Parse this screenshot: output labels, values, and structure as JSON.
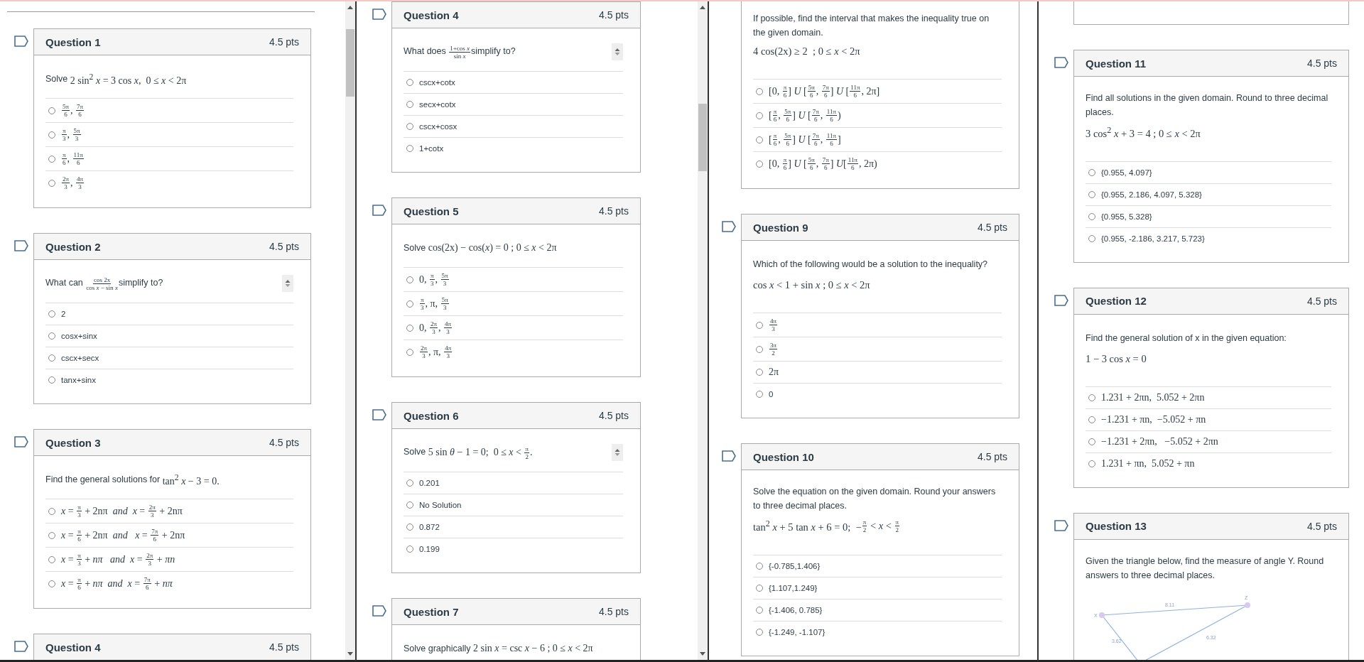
{
  "panes": [
    {
      "leading_rule": true,
      "scrollbar": true,
      "questions": [
        {
          "title": "Question 1",
          "points": "4.5 pts",
          "prompt": [
            "Solve ",
            {
              "math": [
                "2 sin$^{2}$ *x* = 3 cos *x*,  0 ≤ *x* < 2π"
              ]
            }
          ],
          "options": [
            {
              "selected": false,
              "math": [
                [
                  "5π",
                  "6"
                ],
                ", ",
                [
                  "7π",
                  "6"
                ]
              ]
            },
            {
              "selected": false,
              "math": [
                [
                  "π",
                  "3"
                ],
                ", ",
                [
                  "5π",
                  "3"
                ]
              ]
            },
            {
              "selected": false,
              "math": [
                [
                  "π",
                  "6"
                ],
                ", ",
                [
                  "11π",
                  "6"
                ]
              ]
            },
            {
              "selected": false,
              "math": [
                [
                  "2π",
                  "3"
                ],
                ", ",
                [
                  "4π",
                  "3"
                ]
              ]
            }
          ]
        },
        {
          "title": "Question 2",
          "points": "4.5 pts",
          "spinner": true,
          "prompt": [
            "What can ",
            {
              "math": [
                [
                  "cos 2x",
                  "cos *x* − sin *x*"
                ]
              ]
            },
            "simplify to?"
          ],
          "options": [
            {
              "selected": false,
              "text": "2"
            },
            {
              "selected": false,
              "text": "cosx+sinx"
            },
            {
              "selected": false,
              "text": "cscx+secx"
            },
            {
              "selected": false,
              "text": "tanx+sinx"
            }
          ]
        },
        {
          "title": "Question 3",
          "points": "4.5 pts",
          "prompt": [
            "Find the general solutions for ",
            {
              "math": [
                "tan$^{2}$ *x* − 3 = 0."
              ]
            }
          ],
          "options": [
            {
              "selected": false,
              "math": [
                "*x* = ",
                [
                  "π",
                  "3"
                ],
                " + 2nπ  *and*  *x* = ",
                [
                  "2π",
                  "3"
                ],
                " + 2nπ"
              ]
            },
            {
              "selected": false,
              "math": [
                "*x* = ",
                [
                  "π",
                  "6"
                ],
                " + 2nπ  *and*   *x* = ",
                [
                  "7π",
                  "6"
                ],
                " + 2nπ"
              ]
            },
            {
              "selected": false,
              "math": [
                "*x* = ",
                [
                  "π",
                  "3"
                ],
                " + *nπ*   *and*  *x* = ",
                [
                  "2π",
                  "3"
                ],
                " + *πn*"
              ]
            },
            {
              "selected": false,
              "math": [
                "*x* = ",
                [
                  "π",
                  "6"
                ],
                " + *nπ*  *and*  *x* = ",
                [
                  "7π",
                  "6"
                ],
                " + *nπ*"
              ]
            }
          ]
        },
        {
          "title": "Question 4",
          "points": "4.5 pts"
        }
      ]
    },
    {
      "scrollbar": true,
      "questions": [
        {
          "title": "Question 4",
          "points": "4.5 pts",
          "spinner": true,
          "prompt": [
            "What does ",
            {
              "math": [
                [
                  "1+cos *x*",
                  "sin *x*"
                ]
              ]
            },
            "simplify to?"
          ],
          "options": [
            {
              "selected": false,
              "text": "cscx+cotx"
            },
            {
              "selected": false,
              "text": "secx+cotx"
            },
            {
              "selected": false,
              "text": "cscx+cosx"
            },
            {
              "selected": false,
              "text": "1+cotx"
            }
          ]
        },
        {
          "title": "Question 5",
          "points": "4.5 pts",
          "prompt": [
            "Solve ",
            {
              "math": [
                "cos(2x) − cos(*x*) = 0 ; 0 ≤ *x* < 2π"
              ]
            }
          ],
          "options": [
            {
              "selected": false,
              "math": [
                "0, ",
                [
                  "π",
                  "3"
                ],
                ", ",
                [
                  "5π",
                  "3"
                ]
              ]
            },
            {
              "selected": false,
              "math": [
                [
                  "π",
                  "3"
                ],
                ", π, ",
                [
                  "5π",
                  "3"
                ]
              ]
            },
            {
              "selected": false,
              "math": [
                "0, ",
                [
                  "2π",
                  "3"
                ],
                ", ",
                [
                  "4π",
                  "3"
                ]
              ]
            },
            {
              "selected": false,
              "math": [
                [
                  "2π",
                  "3"
                ],
                ", π, ",
                [
                  "4π",
                  "3"
                ]
              ]
            }
          ]
        },
        {
          "title": "Question 6",
          "points": "4.5 pts",
          "spinner": true,
          "prompt": [
            "Solve ",
            {
              "math": [
                "5 sin *θ* − 1 = 0;  0 ≤ *x* < ",
                [
                  "π",
                  "2"
                ],
                "."
              ]
            }
          ],
          "options": [
            {
              "selected": false,
              "text": "0.201"
            },
            {
              "selected": false,
              "text": "No Solution"
            },
            {
              "selected": false,
              "text": "0.872"
            },
            {
              "selected": false,
              "text": "0.199"
            }
          ]
        },
        {
          "title": "Question 7",
          "points": "4.5 pts",
          "prompt": [
            "Solve graphically ",
            {
              "math": [
                "2 sin *x* = csc *x* − 6 ; 0 ≤ *x* < 2π"
              ]
            }
          ]
        }
      ]
    },
    {
      "questions": [
        {
          "prompt": [
            "If possible, find the interval that makes the inequality true on the given domain."
          ],
          "equation": [
            "4 cos(2x) ≥ 2  ; 0 ≤ *x* < 2π"
          ],
          "options": [
            {
              "selected": false,
              "math": [
                "[0, ",
                [
                  "π",
                  "6"
                ],
                "] *U* [",
                [
                  "5π",
                  "6"
                ],
                ", ",
                [
                  "7π",
                  "6"
                ],
                "] *U* [",
                [
                  "11π",
                  "6"
                ],
                ", 2π]"
              ]
            },
            {
              "selected": false,
              "math": [
                "[",
                [
                  "π",
                  "6"
                ],
                ", ",
                [
                  "5π",
                  "6"
                ],
                "] *U* [",
                [
                  "7π",
                  "6"
                ],
                ", ",
                [
                  "11π",
                  "6"
                ],
                ")"
              ]
            },
            {
              "selected": false,
              "math": [
                "[",
                [
                  "π",
                  "6"
                ],
                ", ",
                [
                  "5π",
                  "6"
                ],
                "] *U* [",
                [
                  "7π",
                  "6"
                ],
                ", ",
                [
                  "11π",
                  "6"
                ],
                "]"
              ]
            },
            {
              "selected": false,
              "math": [
                "[0, ",
                [
                  "π",
                  "6"
                ],
                "] *U* [",
                [
                  "5π",
                  "6"
                ],
                ", ",
                [
                  "7π",
                  "6"
                ],
                "] *U*[",
                [
                  "11π",
                  "6"
                ],
                ", 2π)"
              ]
            }
          ]
        },
        {
          "title": "Question 9",
          "points": "4.5 pts",
          "prompt": [
            "Which of the following would be a solution to the inequality?"
          ],
          "equation": [
            "cos *x* < 1 + sin *x* ; 0 ≤ *x* < 2π"
          ],
          "options": [
            {
              "selected": false,
              "math": [
                [
                  "4π",
                  "3"
                ]
              ]
            },
            {
              "selected": false,
              "math": [
                [
                  "3π",
                  "2"
                ]
              ]
            },
            {
              "selected": false,
              "math": [
                "2π"
              ]
            },
            {
              "selected": false,
              "text": "0"
            }
          ]
        },
        {
          "title": "Question 10",
          "points": "4.5 pts",
          "prompt": [
            "Solve the equation on the given domain. Round your answers to three decimal places."
          ],
          "equation": [
            "tan$^{2}$ *x* + 5 tan *x* + 6 = 0;  −",
            [
              "π",
              "2"
            ],
            " < *x* < ",
            [
              "π",
              "2"
            ]
          ],
          "options": [
            {
              "selected": false,
              "text": "{-0.785,1.406}"
            },
            {
              "selected": false,
              "text": "{1.107,1.249}"
            },
            {
              "selected": false,
              "text": "{-1.406, 0.785}"
            },
            {
              "selected": false,
              "text": "{-1.249, -1.107}"
            }
          ]
        }
      ]
    },
    {
      "continued": true,
      "questions": [
        {
          "title": "Question 11",
          "points": "4.5 pts",
          "prompt": [
            "Find all solutions in the given domain. Round to three decimal places."
          ],
          "equation": [
            "3 cos$^{2}$ *x* + 3 = 4 ; 0 ≤ *x* < 2π"
          ],
          "options": [
            {
              "selected": false,
              "text": "{0.955, 4.097}"
            },
            {
              "selected": false,
              "text": "{0.955, 2.186, 4.097, 5.328}"
            },
            {
              "selected": false,
              "text": "{0.955, 5.328}"
            },
            {
              "selected": false,
              "text": "{0.955, -2.186, 3.217, 5.723}"
            }
          ]
        },
        {
          "title": "Question 12",
          "points": "4.5 pts",
          "prompt": [
            "Find the general solution of x in the given equation:"
          ],
          "equation": [
            "1 − 3 cos *x* = 0"
          ],
          "options": [
            {
              "selected": false,
              "math": [
                "1.231 + 2πn,  5.052 + 2πn"
              ]
            },
            {
              "selected": false,
              "math": [
                "−1.231 + πn,  −5.052 + πn"
              ]
            },
            {
              "selected": false,
              "math": [
                "−1.231 + 2πn,   −5.052 + 2πn"
              ]
            },
            {
              "selected": false,
              "math": [
                "1.231 + πn,  5.052 + πn"
              ]
            }
          ]
        },
        {
          "title": "Question 13",
          "points": "4.5 pts",
          "prompt": [
            "Given the triangle below, find the measure of angle Y. Round answers to three decimal places."
          ],
          "figure": {
            "vertices": [
              "X",
              "Z"
            ],
            "sides": [
              "8.11",
              "6.32",
              "3.62"
            ]
          }
        }
      ]
    }
  ]
}
